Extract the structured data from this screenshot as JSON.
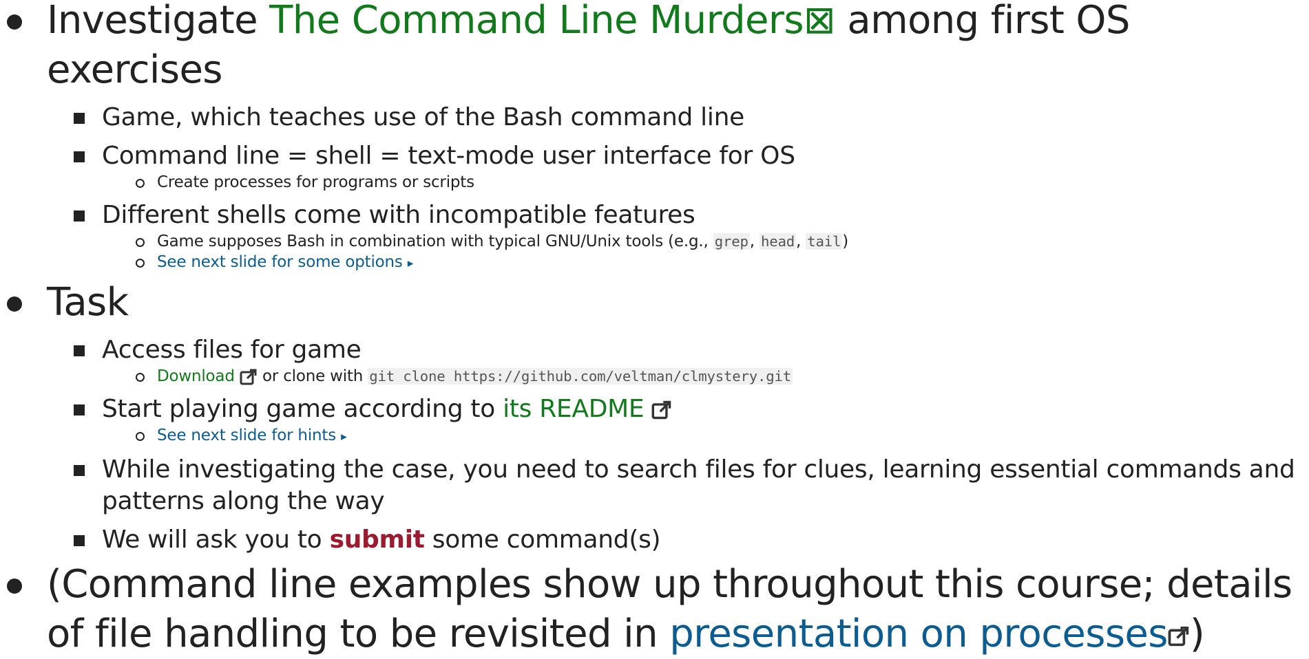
{
  "bullets": [
    {
      "pre": "Investigate ",
      "link": "The Command Line Murders",
      "link_icon": "⊠",
      "post": " among first OS exercises",
      "sub": [
        {
          "text": "Game, which teaches use of the Bash command line"
        },
        {
          "text": "Command line = shell = text-mode user interface for OS",
          "sub": [
            "Create processes for programs or scripts"
          ]
        },
        {
          "text": "Different shells come with incompatible features",
          "sub_game": {
            "pre": "Game supposes Bash in combination with typical GNU/Unix tools (e.g., ",
            "code1": "grep",
            "sep1": ", ",
            "code2": "head",
            "sep2": ", ",
            "code3": "tail",
            "post": ")"
          },
          "sub_link": "See next slide for some options",
          "arrow": "▸"
        }
      ]
    },
    {
      "text": "Task",
      "sub": [
        {
          "text": "Access files for game",
          "download": "Download",
          "download_post": " or clone with ",
          "code": "git clone https://github.com/veltman/clmystery.git"
        },
        {
          "pre": "Start playing game according to ",
          "link": "its README",
          "sub_link": "See next slide for hints",
          "arrow": "▸"
        },
        {
          "text": "While investigating the case, you need to search files for clues, learning essential commands and patterns along the way"
        },
        {
          "pre": "We will ask you to ",
          "bold": "submit",
          "post": " some command(s)"
        }
      ]
    },
    {
      "pre": "(Command line examples show up throughout this course; details of file handling to be revisited in ",
      "link": "presentation on processes",
      "post": ")"
    }
  ],
  "colors": {
    "link_green": "#117a1a",
    "link_blue": "#0b5d91",
    "emphasis": "#9b1b30"
  },
  "icons": {
    "external": "external-link-icon"
  }
}
